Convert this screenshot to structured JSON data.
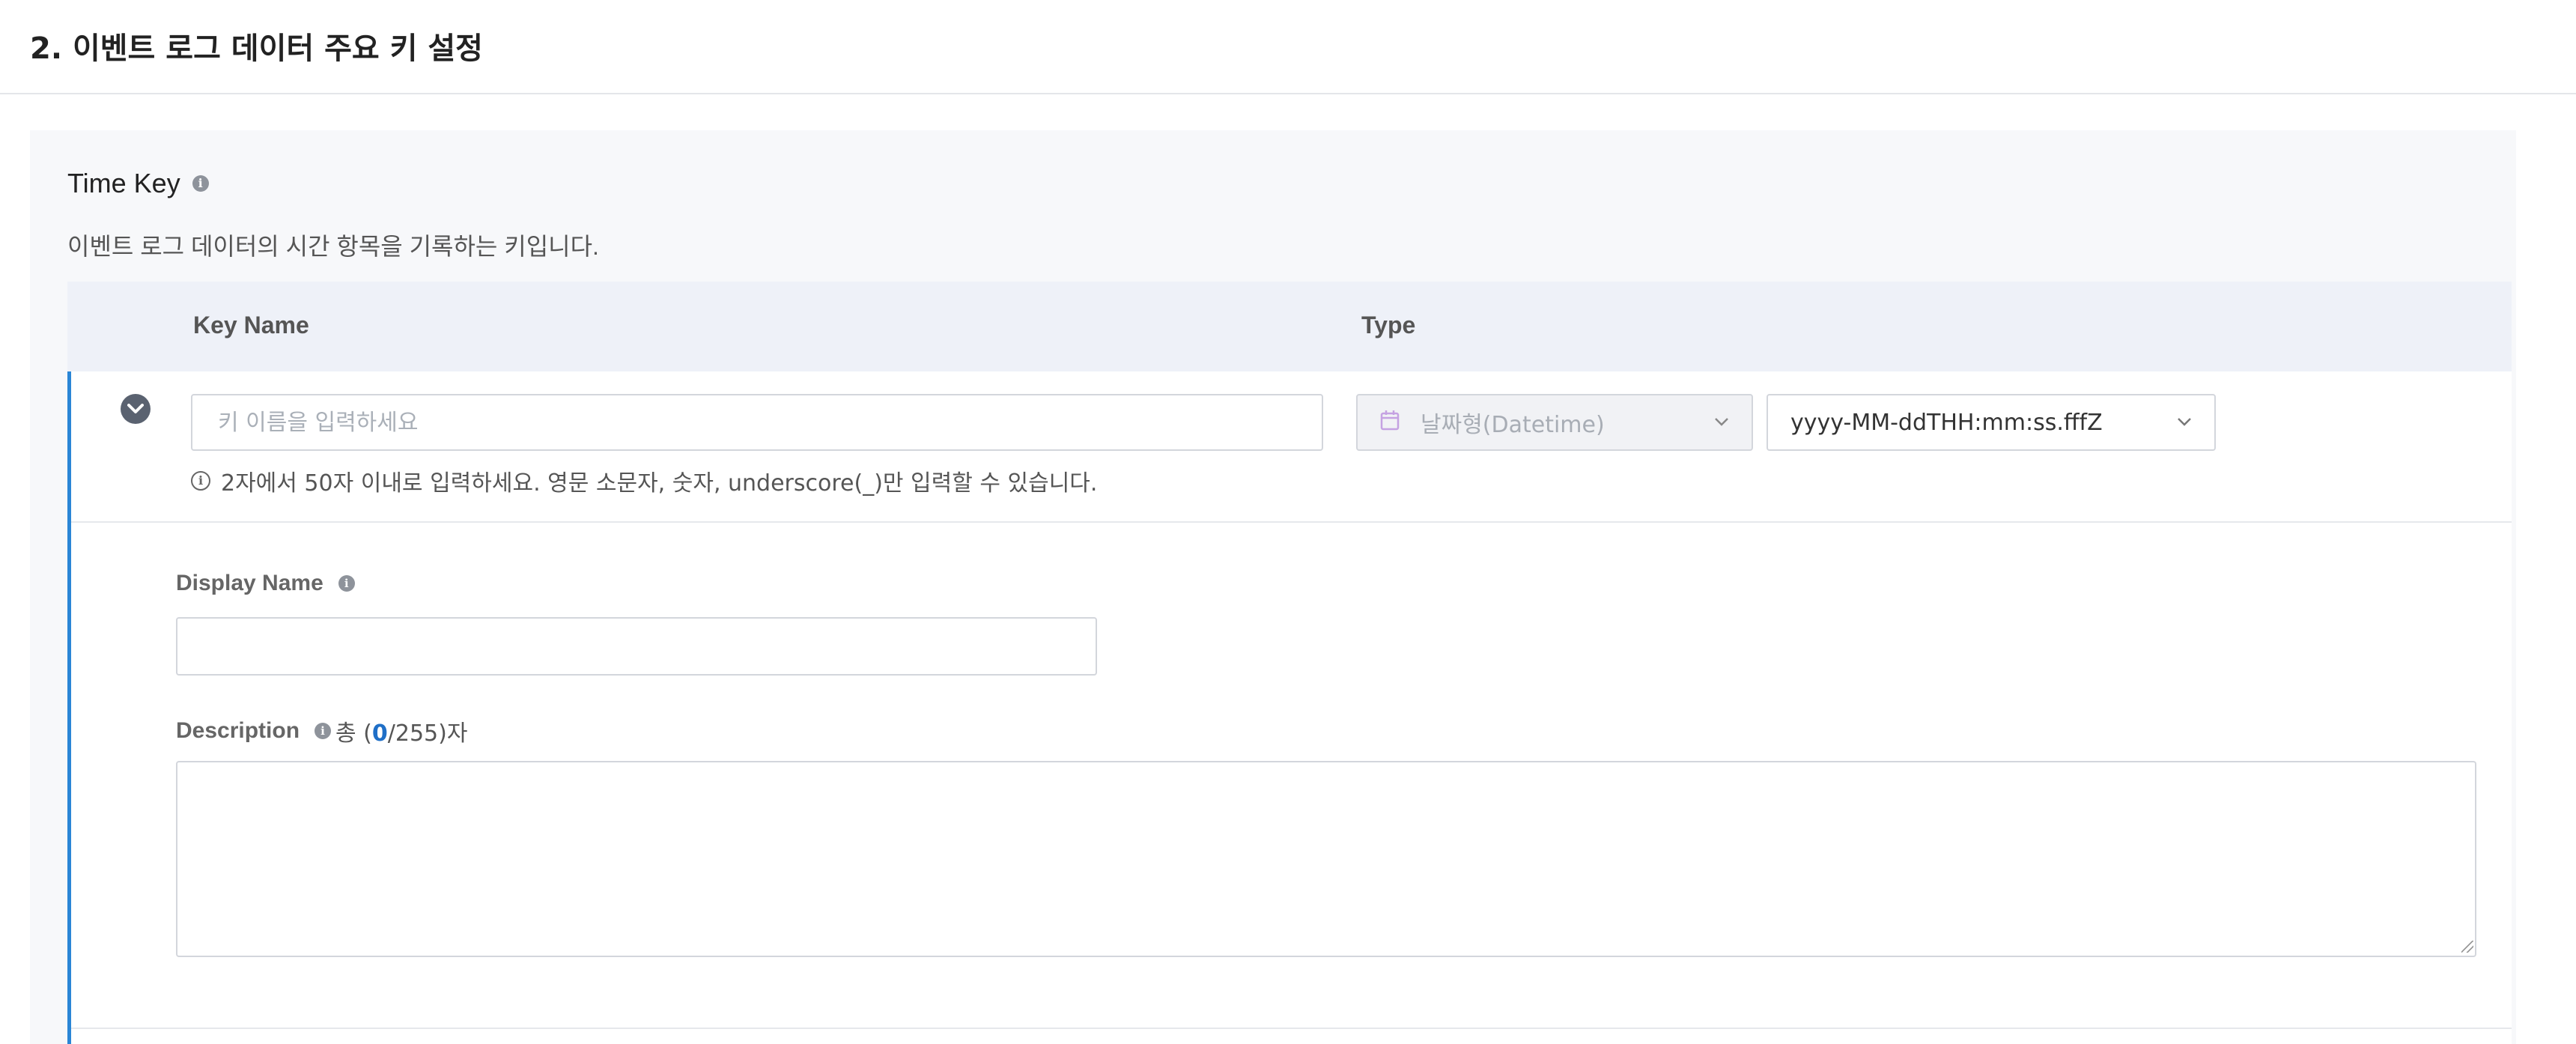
{
  "page": {
    "title": "2. 이벤트 로그 데이터 주요 키 설정"
  },
  "time_key": {
    "title": "Time Key",
    "description": "이벤트 로그 데이터의 시간 항목을 기록하는 키입니다.",
    "info_icon": "i",
    "table": {
      "headers": {
        "key_name": "Key Name",
        "type": "Type"
      },
      "row": {
        "key_name_placeholder": "키 이름을 입력하세요",
        "key_name_value": "",
        "hint": "2자에서 50자 이내로 입력하세요. 영문 소문자, 숫자, underscore(_)만 입력할 수 있습니다.",
        "hint_icon": "i",
        "type_value": "날짜형(Datetime)",
        "format_value": "yyyy-MM-ddTHH:mm:ss.fffZ",
        "display_name_label": "Display Name",
        "display_name_value": "",
        "description_label": "Description",
        "counter_prefix": "총 (",
        "counter_current": "0",
        "counter_suffix": "/255)자",
        "description_value": ""
      }
    }
  },
  "icons": {
    "toggle": "chevron-down-circle-icon",
    "calendar": "calendar-icon",
    "chevron": "chevron-down-icon",
    "info": "info-icon"
  },
  "colors": {
    "accent": "#2a86d6",
    "counter": "#1f6fc7",
    "calendar": "#b18ad6"
  }
}
